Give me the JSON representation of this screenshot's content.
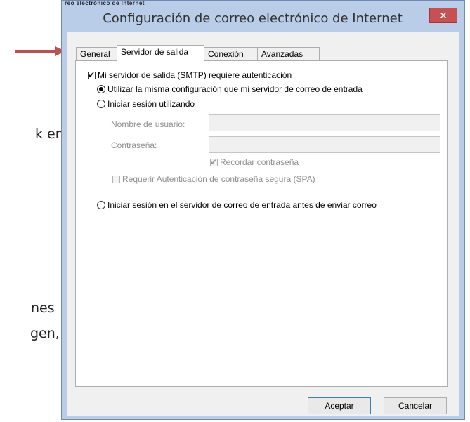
{
  "background": {
    "line1": "k en",
    "line2": "nes",
    "line3": "gen,",
    "top_partial_title": "reo electrónico de Internet"
  },
  "dialog": {
    "title": "Configuración de correo electrónico de Internet",
    "close_symbol": "✕",
    "tabs": [
      "General",
      "Servidor de salida",
      "Conexión",
      "Avanzadas"
    ],
    "active_tab": "Servidor de salida",
    "smtp_auth_label": "Mi servidor de salida (SMTP) requiere autenticación",
    "smtp_auth_checked": true,
    "option_same_label": "Utilizar la misma configuración que mi servidor de correo de entrada",
    "option_login_label": "Iniciar sesión utilizando",
    "username_label": "Nombre de usuario:",
    "username_value": "",
    "password_label": "Contraseña:",
    "password_value": "",
    "remember_password_label": "Recordar contraseña",
    "remember_password_checked": true,
    "spa_label": "Requerir Autenticación de contraseña segura (SPA)",
    "spa_checked": false,
    "option_pop_label": "Iniciar sesión en el servidor de correo de entrada antes de enviar correo",
    "selected_option": "same",
    "accept_label": "Aceptar",
    "cancel_label": "Cancelar"
  },
  "colors": {
    "frame": "#b9cde9",
    "close_button": "#c75050",
    "arrow": "#c0504d"
  }
}
